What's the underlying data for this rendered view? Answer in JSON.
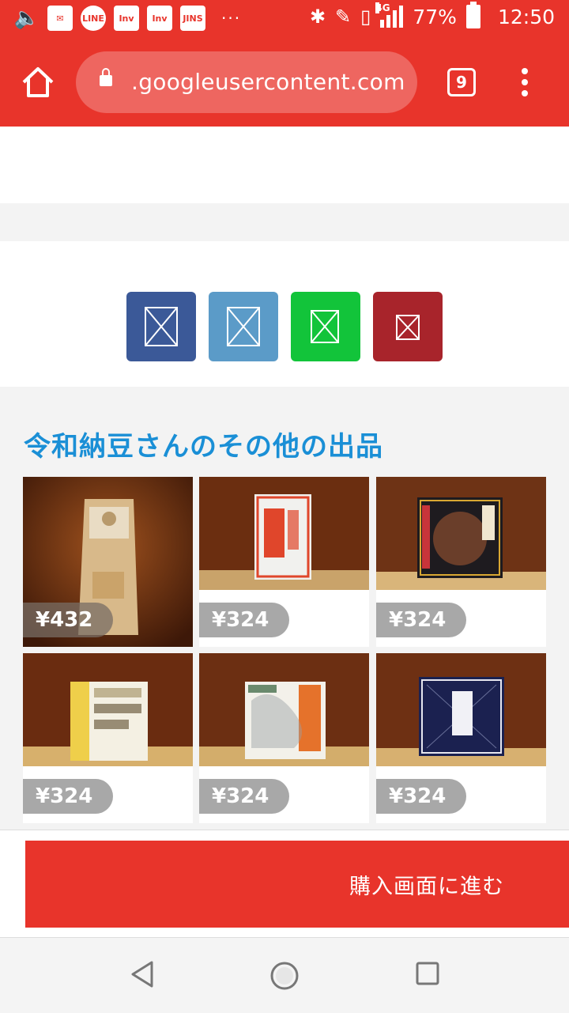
{
  "status_bar": {
    "notification_icons": [
      "speaker-icon",
      "au-mail-icon",
      "line-icon",
      "inv-icon",
      "inv-icon",
      "jins-icon"
    ],
    "labels": {
      "line": "LINE",
      "inv": "Inv",
      "jins": "JINS"
    },
    "overflow": "···",
    "network": "4G",
    "battery": "77%",
    "time": "12:50"
  },
  "toolbar": {
    "url": ".googleusercontent.com",
    "tab_count": "9"
  },
  "share_buttons": [
    {
      "name": "share-facebook",
      "color": "#3b5998"
    },
    {
      "name": "share-twitter",
      "color": "#5b9bc8"
    },
    {
      "name": "share-line",
      "color": "#12c43a"
    },
    {
      "name": "share-hatena",
      "color": "#a8242b"
    }
  ],
  "section": {
    "title": "令和納豆さんのその他の出品"
  },
  "products": [
    {
      "price": "¥432"
    },
    {
      "price": "¥324"
    },
    {
      "price": "¥324"
    },
    {
      "price": "¥324"
    },
    {
      "price": "¥324"
    },
    {
      "price": "¥324"
    }
  ],
  "buy_button": {
    "label": "購入画面に進む"
  },
  "colors": {
    "brand_red": "#e8342b",
    "title_blue": "#1a8fd6",
    "price_gray": "#a8a8a8"
  }
}
